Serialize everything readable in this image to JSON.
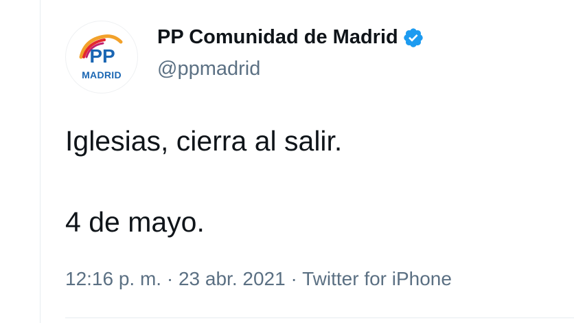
{
  "account": {
    "display_name": "PP Comunidad de Madrid",
    "handle": "@ppmadrid",
    "verified": true,
    "avatar_label": "MADRID",
    "avatar_logo": "PP"
  },
  "tweet": {
    "lines": [
      "Iglesias, cierra al salir.",
      "4 de mayo."
    ]
  },
  "meta": {
    "time": "12:16 p. m.",
    "separator": " · ",
    "date": "23 abr. 2021",
    "source": "Twitter for iPhone"
  },
  "colors": {
    "text": "#0f1419",
    "secondary": "#5b7083",
    "verified_badge": "#1d9bf0",
    "pp_blue": "#1a66b3"
  }
}
